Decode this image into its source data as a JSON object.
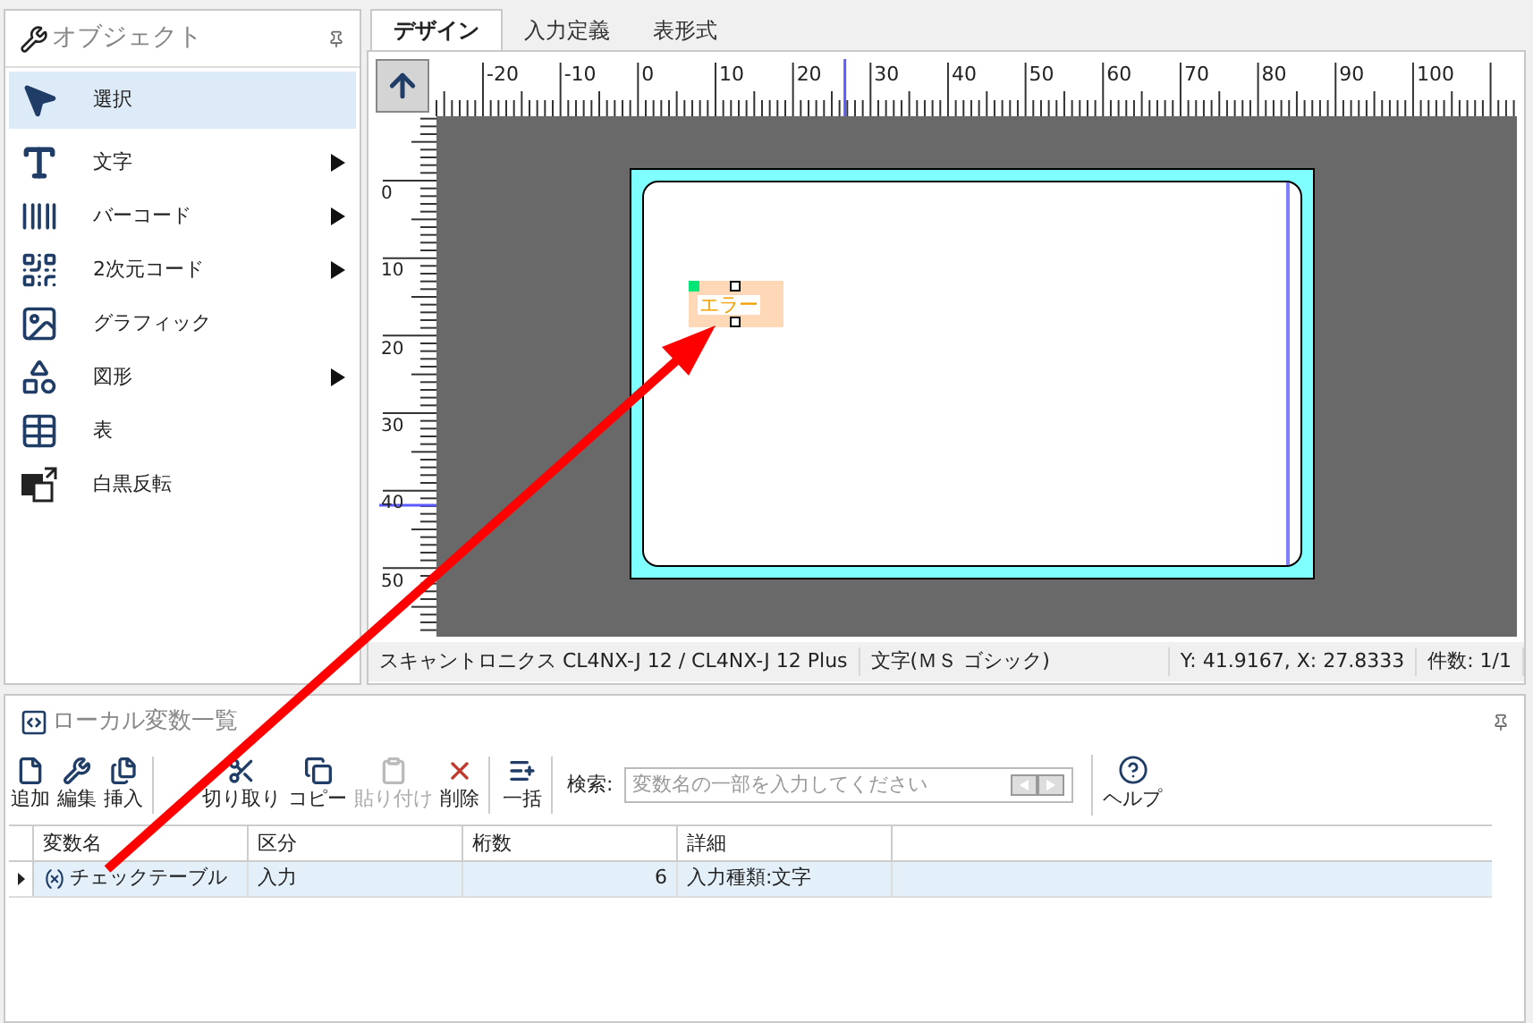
{
  "objects_panel": {
    "title": "オブジェクト",
    "items": [
      {
        "label": "選択",
        "selected": true,
        "submenu": false
      },
      {
        "label": "文字",
        "selected": false,
        "submenu": true
      },
      {
        "label": "バーコード",
        "selected": false,
        "submenu": true
      },
      {
        "label": "2次元コード",
        "selected": false,
        "submenu": true
      },
      {
        "label": "グラフィック",
        "selected": false,
        "submenu": false
      },
      {
        "label": "図形",
        "selected": false,
        "submenu": true
      },
      {
        "label": "表",
        "selected": false,
        "submenu": false
      },
      {
        "label": "白黒反転",
        "selected": false,
        "submenu": false
      }
    ]
  },
  "tabs": [
    {
      "label": "デザイン",
      "selected": true
    },
    {
      "label": "入力定義",
      "selected": false
    },
    {
      "label": "表形式",
      "selected": false
    }
  ],
  "ruler": {
    "top_labels": [
      "-20",
      "-10",
      "0",
      "10",
      "20",
      "30",
      "40",
      "50",
      "60",
      "70",
      "80",
      "90",
      "100"
    ],
    "left_labels": [
      "0",
      "10",
      "20",
      "30",
      "40",
      "50"
    ]
  },
  "label_canvas": {
    "text_object": "エラー"
  },
  "status_bar": [
    "スキャントロニクス CL4NX-J 12 / CL4NX-J 12 Plus",
    "文字(ＭＳ ゴシック)",
    "Y: 41.9167, X: 27.8333",
    "件数: 1/1"
  ],
  "variables_panel": {
    "title": "ローカル変数一覧",
    "toolbar": {
      "groups": [
        [
          {
            "label": "追加",
            "disabled": false
          },
          {
            "label": "編集",
            "disabled": false
          },
          {
            "label": "挿入",
            "disabled": false
          }
        ],
        [
          {
            "label": "切り取り",
            "disabled": false
          },
          {
            "label": "コピー",
            "disabled": false
          },
          {
            "label": "貼り付け",
            "disabled": true
          },
          {
            "label": "削除",
            "disabled": false
          }
        ],
        [
          {
            "label": "一括",
            "disabled": false
          }
        ]
      ],
      "search_label": "検索:",
      "search": {
        "placeholder": "変数名の一部を入力してください"
      },
      "help": "ヘルプ"
    },
    "table": {
      "columns": [
        "変数名",
        "区分",
        "桁数",
        "詳細"
      ],
      "rows": [
        {
          "selected": true,
          "cells": [
            "チェックテーブル",
            "入力",
            "6",
            "入力種類:文字"
          ]
        }
      ]
    }
  }
}
